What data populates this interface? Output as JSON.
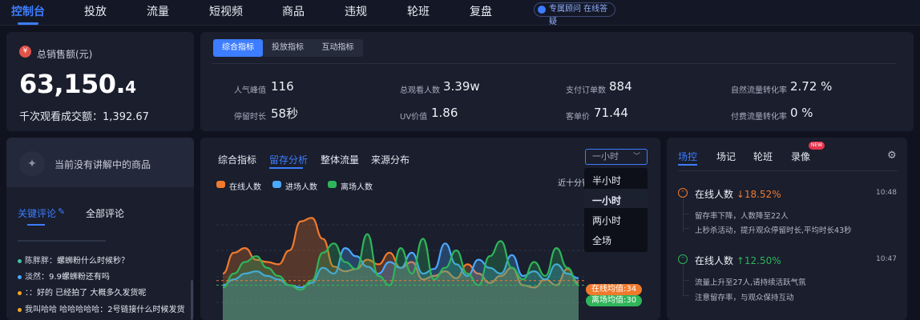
{
  "nav": {
    "items": [
      "控制台",
      "投放",
      "流量",
      "短视频",
      "商品",
      "违规",
      "轮班",
      "复盘"
    ],
    "advisor": "专属顾问 在线答疑"
  },
  "sales": {
    "title": "总销售额(元)",
    "value_main": "63,150.",
    "value_dec": "4",
    "sub_label": "千次观看成交额：",
    "sub_value": "1,392.67"
  },
  "metrics": {
    "tabs": [
      "综合指标",
      "投放指标",
      "互动指标"
    ],
    "items": [
      {
        "label": "人气峰值",
        "value": "116"
      },
      {
        "label": "总观看人数",
        "value": "3.39w"
      },
      {
        "label": "支付订单数",
        "value": "884"
      },
      {
        "label": "自然流量转化率",
        "value": "2.72 %"
      },
      {
        "label": "停留时长",
        "value": "58秒"
      },
      {
        "label": "UV价值",
        "value": "1.86"
      },
      {
        "label": "客单价",
        "value": "71.44"
      },
      {
        "label": "付费流量转化率",
        "value": "0 %"
      }
    ]
  },
  "product": {
    "empty_text": "当前没有讲解中的商品"
  },
  "comments": {
    "tabs": [
      "关键评论",
      "全部评论"
    ],
    "items": [
      {
        "user": "陈胖胖",
        "text": "螺蛳粉什么时候秒？",
        "color": "#3fc2a5"
      },
      {
        "user": "淡然",
        "text": "9.9螺蛳粉还有吗",
        "color": "#4aa8ff"
      },
      {
        "user": "：",
        "text": "好的 已经拍了 大概多久发货呢",
        "color": "#f5a623"
      },
      {
        "user": "我叫哈哈 哈哈哈哈哈",
        "text": "2号链接什么时候发货",
        "color": "#f5a623"
      }
    ]
  },
  "chart_panel": {
    "tabs": [
      "综合指标",
      "留存分析",
      "整体流量",
      "来源分布"
    ],
    "dropdown_value": "一小时",
    "dropdown_options": [
      "半小时",
      "一小时",
      "两小时",
      "全场"
    ],
    "recent_label": "近十分钟",
    "legend": [
      {
        "name": "在线人数",
        "color": "#f07a2c"
      },
      {
        "name": "进场人数",
        "color": "#4aa8ff"
      },
      {
        "name": "离场人数",
        "color": "#2fb55a"
      }
    ],
    "avg_online": "在线均值:34",
    "avg_entry": "离场均值:30"
  },
  "chart_data": {
    "type": "line",
    "series": [
      {
        "name": "在线人数",
        "values": [
          40,
          58,
          62,
          52,
          50,
          48,
          60,
          85,
          88,
          70,
          46,
          42,
          44,
          52,
          48,
          58,
          45,
          50,
          35,
          38,
          42,
          36,
          48,
          40,
          32,
          38,
          45,
          30,
          28,
          35,
          30,
          44,
          32
        ]
      },
      {
        "name": "进场人数",
        "values": [
          30,
          35,
          40,
          42,
          38,
          35,
          30,
          28,
          32,
          45,
          40,
          62,
          55,
          46,
          40,
          50,
          45,
          58,
          40,
          44,
          66,
          48,
          38,
          52,
          45,
          40,
          56,
          38,
          42,
          35,
          48,
          40,
          36
        ]
      },
      {
        "name": "离场人数",
        "values": [
          28,
          40,
          50,
          55,
          45,
          38,
          30,
          26,
          34,
          58,
          66,
          50,
          44,
          74,
          38,
          30,
          62,
          40,
          70,
          35,
          45,
          60,
          40,
          30,
          55,
          68,
          45,
          35,
          50,
          38,
          62,
          45,
          30
        ]
      }
    ]
  },
  "right_panel": {
    "tabs": [
      "场控",
      "场记",
      "轮班",
      "录像"
    ],
    "new_badge": "NEW",
    "timeline": [
      {
        "title": "在线人数",
        "change": "↓18.52%",
        "dir": "down",
        "time": "10:48",
        "events": [
          "留存率下降，人数降至22人",
          "上秒杀活动，提升观众停留时长,平均时长43秒"
        ]
      },
      {
        "title": "在线人数",
        "change": "↑12.50%",
        "dir": "up",
        "time": "10:47",
        "events": [
          "流量上升至27人,请持续活跃气氛",
          "注意留存率，与观众保持互动"
        ]
      }
    ]
  }
}
